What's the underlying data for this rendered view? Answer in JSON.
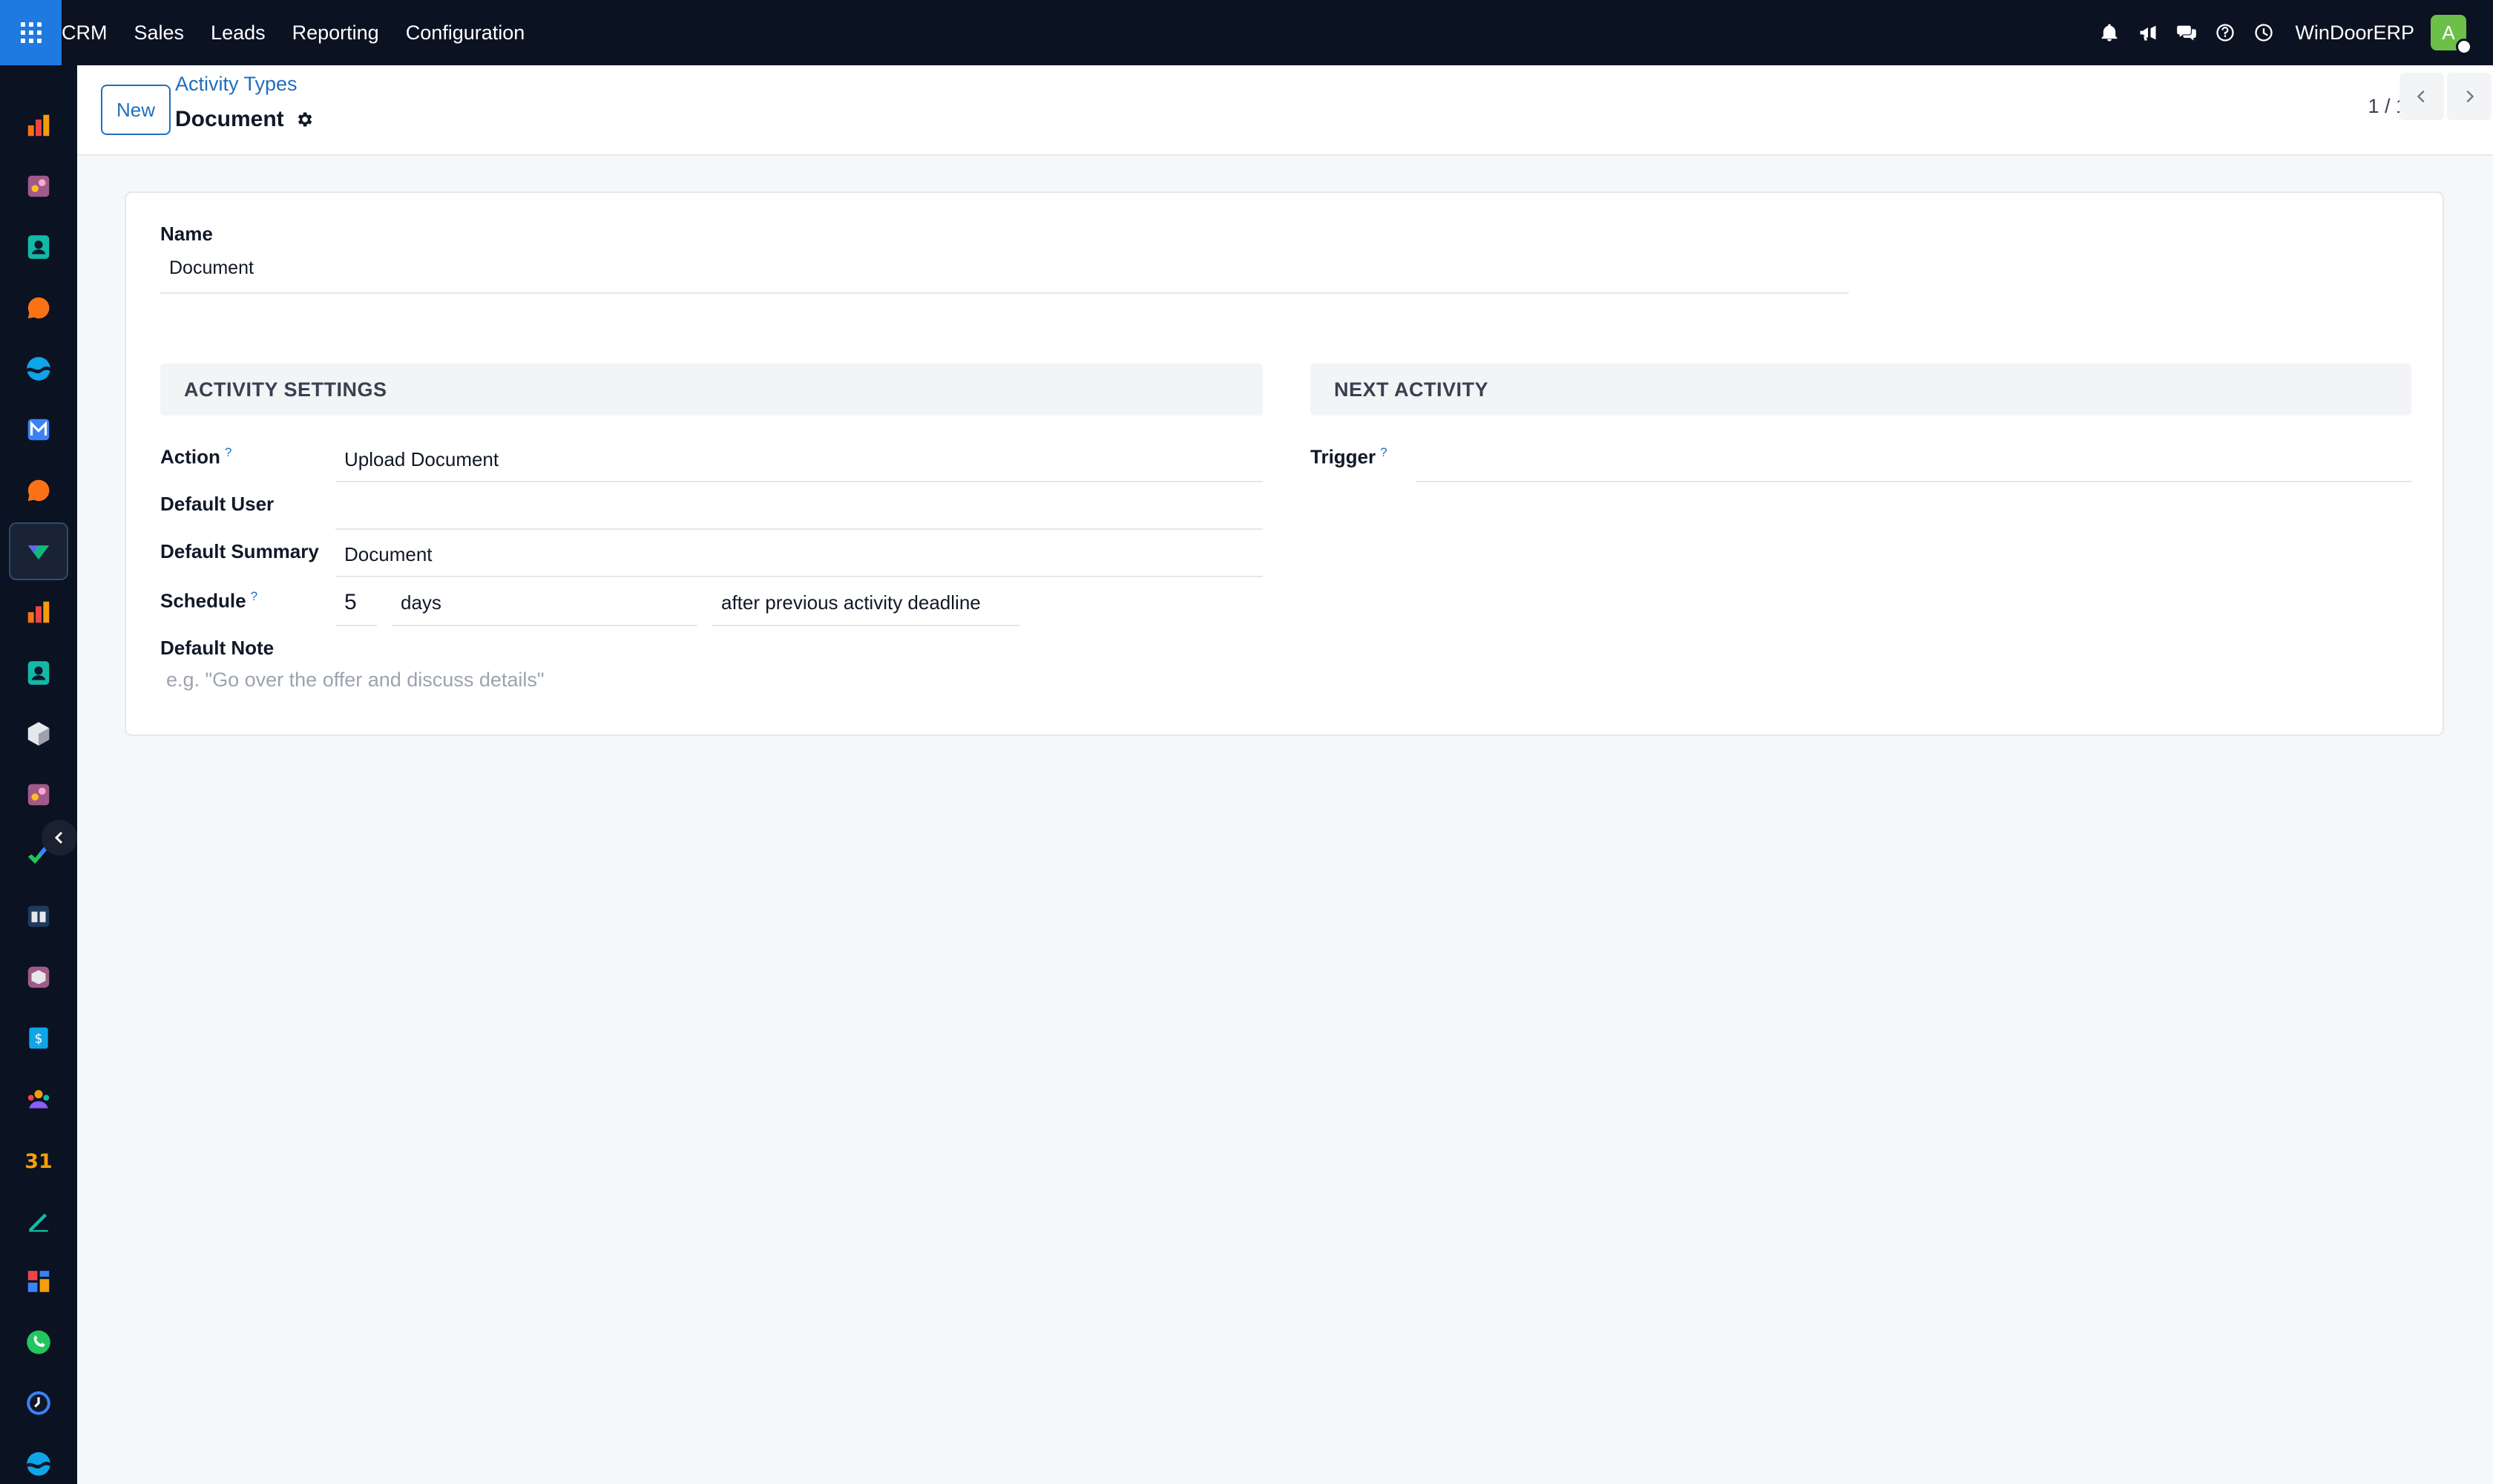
{
  "navbar": {
    "app_name": "CRM",
    "menu": [
      "Sales",
      "Leads",
      "Reporting",
      "Configuration"
    ],
    "company": "WinDoorERP",
    "avatar_initial": "A",
    "icons": [
      "bell-icon",
      "megaphone-icon",
      "chat-icon",
      "help-icon",
      "clock-icon"
    ]
  },
  "sidebar": {
    "apps": [
      "dashboard-icon",
      "puzzle-icon",
      "contacts-icon",
      "discuss-icon",
      "wave-icon",
      "mail-icon",
      "discuss-icon",
      "crm-icon",
      "chart-icon",
      "contacts-icon",
      "cube-icon",
      "puzzle-icon",
      "check-icon",
      "book-icon",
      "box-icon",
      "invoice-icon",
      "team-icon",
      "calendar-icon",
      "sign-icon",
      "grid-icon",
      "whatsapp-icon",
      "clock-icon",
      "wave-icon"
    ],
    "active_index": 7,
    "calendar_text": "31"
  },
  "control_panel": {
    "new_button": "New",
    "breadcrumb": "Activity Types",
    "title": "Document",
    "pager": "1 / 1"
  },
  "form": {
    "name_label": "Name",
    "name_value": "Document",
    "activity_settings": {
      "heading": "ACTIVITY SETTINGS",
      "action_label": "Action",
      "action_value": "Upload Document",
      "default_user_label": "Default User",
      "default_user_value": "",
      "default_summary_label": "Default Summary",
      "default_summary_value": "Document",
      "schedule_label": "Schedule",
      "schedule_count": "5",
      "schedule_unit": "days",
      "schedule_from": "after previous activity deadline",
      "default_note_label": "Default Note",
      "default_note_placeholder": "e.g. \"Go over the offer and discuss details\""
    },
    "next_activity": {
      "heading": "NEXT ACTIVITY",
      "trigger_label": "Trigger",
      "trigger_value": ""
    },
    "help_mark": "?"
  },
  "colors": {
    "navbar_bg": "#0b1222",
    "apps_button": "#1f7ae0",
    "link": "#1f6fbd",
    "avatar": "#6cc04a",
    "background": "#f5f7fa"
  }
}
